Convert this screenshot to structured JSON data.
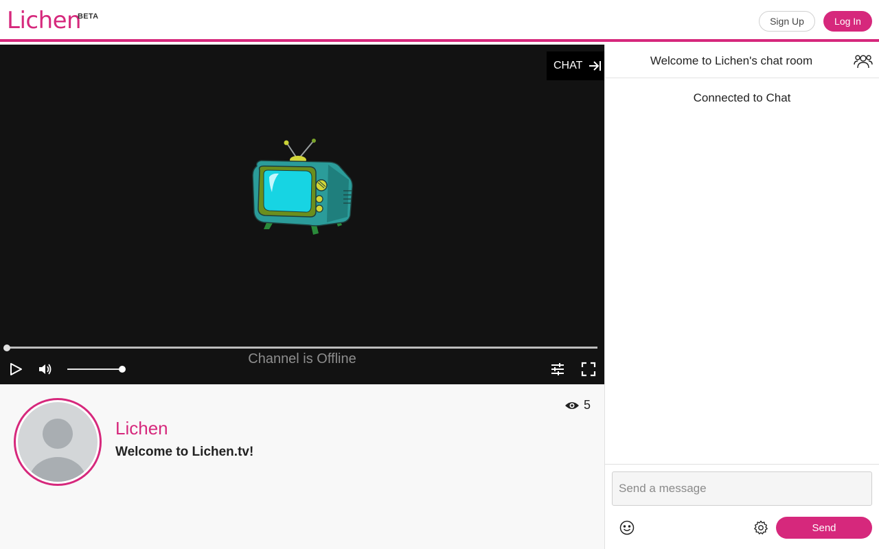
{
  "header": {
    "logo_text": "Lichen",
    "logo_badge": "BETA",
    "signup_label": "Sign Up",
    "login_label": "Log In"
  },
  "player": {
    "chat_toggle_label": "CHAT",
    "offline_text": "Channel is Offline",
    "progress_fraction": 0,
    "volume_fraction": 1
  },
  "channel": {
    "name": "Lichen",
    "description": "Welcome to Lichen.tv!",
    "viewer_count": "5"
  },
  "chat": {
    "title": "Welcome to Lichen's chat room",
    "status": "Connected to Chat",
    "input_placeholder": "Send a message",
    "send_label": "Send"
  },
  "colors": {
    "accent": "#d6287c",
    "player_bg": "#121212",
    "info_bg": "#f8f8f8"
  },
  "icons": [
    "chat-collapse-icon",
    "tv-illustration",
    "play-icon",
    "volume-icon",
    "settings-sliders-icon",
    "fullscreen-icon",
    "eye-icon",
    "users-icon",
    "emoji-icon",
    "gear-icon"
  ]
}
